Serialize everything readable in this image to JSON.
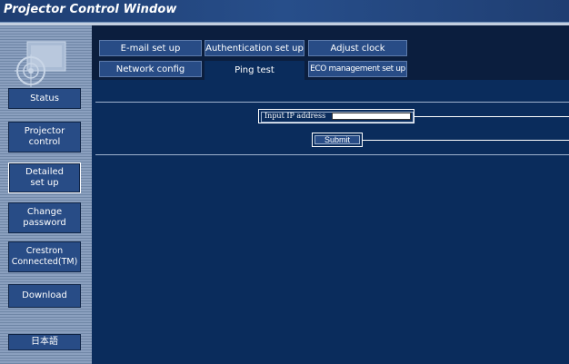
{
  "window": {
    "title": "Projector Control Window"
  },
  "sidebar": {
    "items": [
      {
        "label": "Status"
      },
      {
        "label": "Projector\ncontrol"
      },
      {
        "label": "Detailed\nset up"
      },
      {
        "label": "Change\npassword"
      },
      {
        "label": "Crestron\nConnected(TM)"
      },
      {
        "label": "Download"
      },
      {
        "label": "日本語"
      }
    ]
  },
  "tabs": {
    "row1": [
      {
        "label": "E-mail set up"
      },
      {
        "label": "Authentication set up"
      },
      {
        "label": "Adjust clock"
      }
    ],
    "row2": [
      {
        "label": "Network config"
      },
      {
        "label": "Ping test"
      },
      {
        "label": "ECO management set up"
      }
    ]
  },
  "ping": {
    "ip_label": "Input IP address",
    "ip_value": "",
    "submit_label": "Submit"
  },
  "colors": {
    "accent": "#284c86",
    "background": "#0a2c5c",
    "sidebar": "#8ba0bf"
  }
}
